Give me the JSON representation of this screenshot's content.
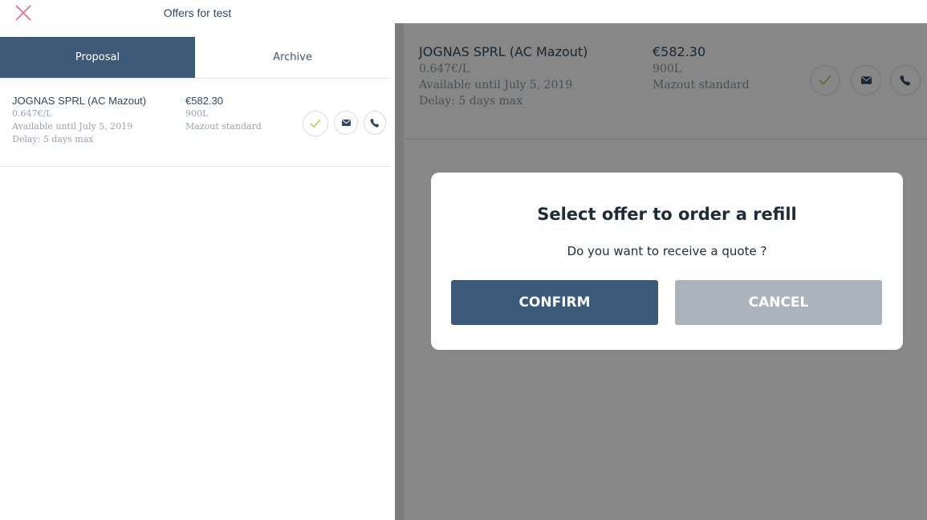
{
  "header": {
    "title": "Offers for test",
    "close_icon": "close-x-icon"
  },
  "tabs": [
    {
      "label": "Proposal",
      "active": true
    },
    {
      "label": "Archive",
      "active": false
    }
  ],
  "offer": {
    "company": "JOGNAS SPRL (AC Mazout)",
    "unit_price": "0.647€/L",
    "availability": "Available until July 5, 2019",
    "delay": "Delay: 5 days max",
    "total": "€582.30",
    "volume": "900L",
    "product": "Mazout standard",
    "actions": [
      "check-icon",
      "mail-icon",
      "phone-icon"
    ]
  },
  "dialog": {
    "title": "Select offer to order a refill",
    "message": "Do you want to receive a quote ?",
    "confirm_label": "CONFIRM",
    "cancel_label": "CANCEL"
  },
  "colors": {
    "primary": "#3c5a78",
    "close_icon": "#e46a8e",
    "check_icon": "#b6cc46",
    "cancel_button": "#abb3bd",
    "overlay": "#858585"
  }
}
